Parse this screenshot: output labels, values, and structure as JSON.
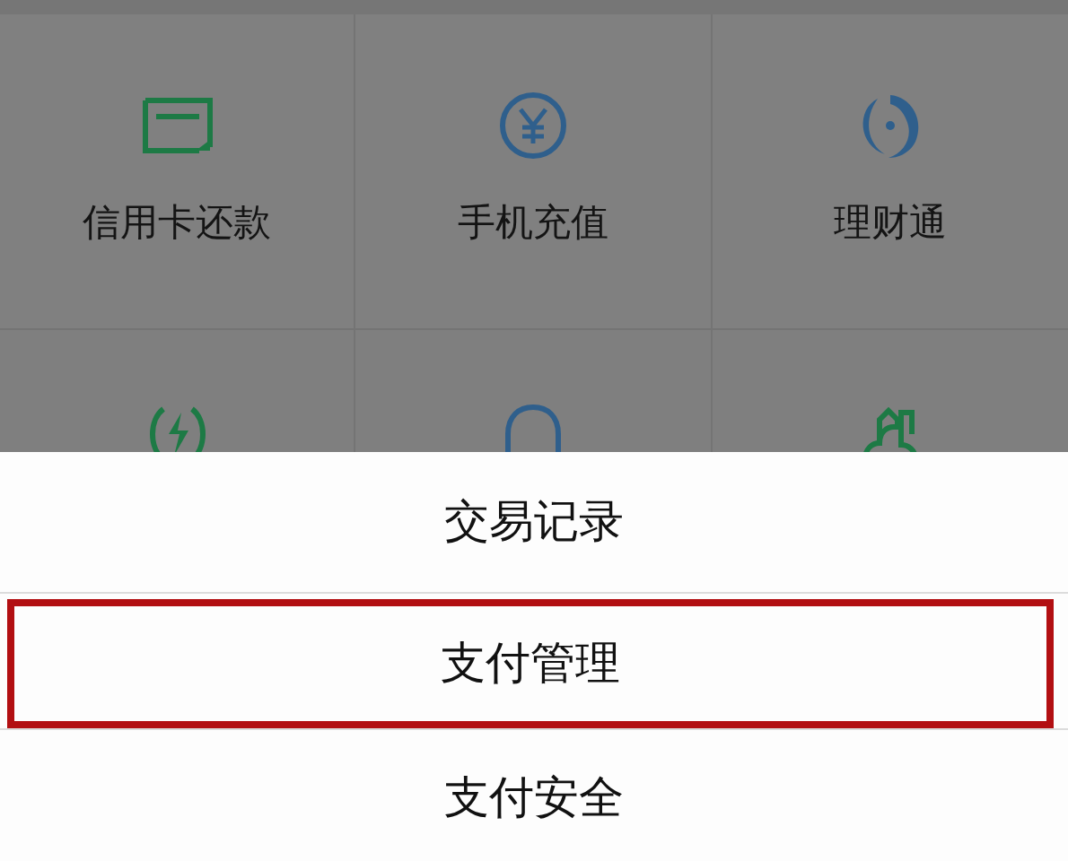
{
  "services": [
    {
      "label": "信用卡还款"
    },
    {
      "label": "手机充值"
    },
    {
      "label": "理财通"
    }
  ],
  "action_sheet": {
    "items": [
      {
        "label": "交易记录",
        "highlighted": false
      },
      {
        "label": "支付管理",
        "highlighted": true
      },
      {
        "label": "支付安全",
        "highlighted": false
      }
    ]
  }
}
